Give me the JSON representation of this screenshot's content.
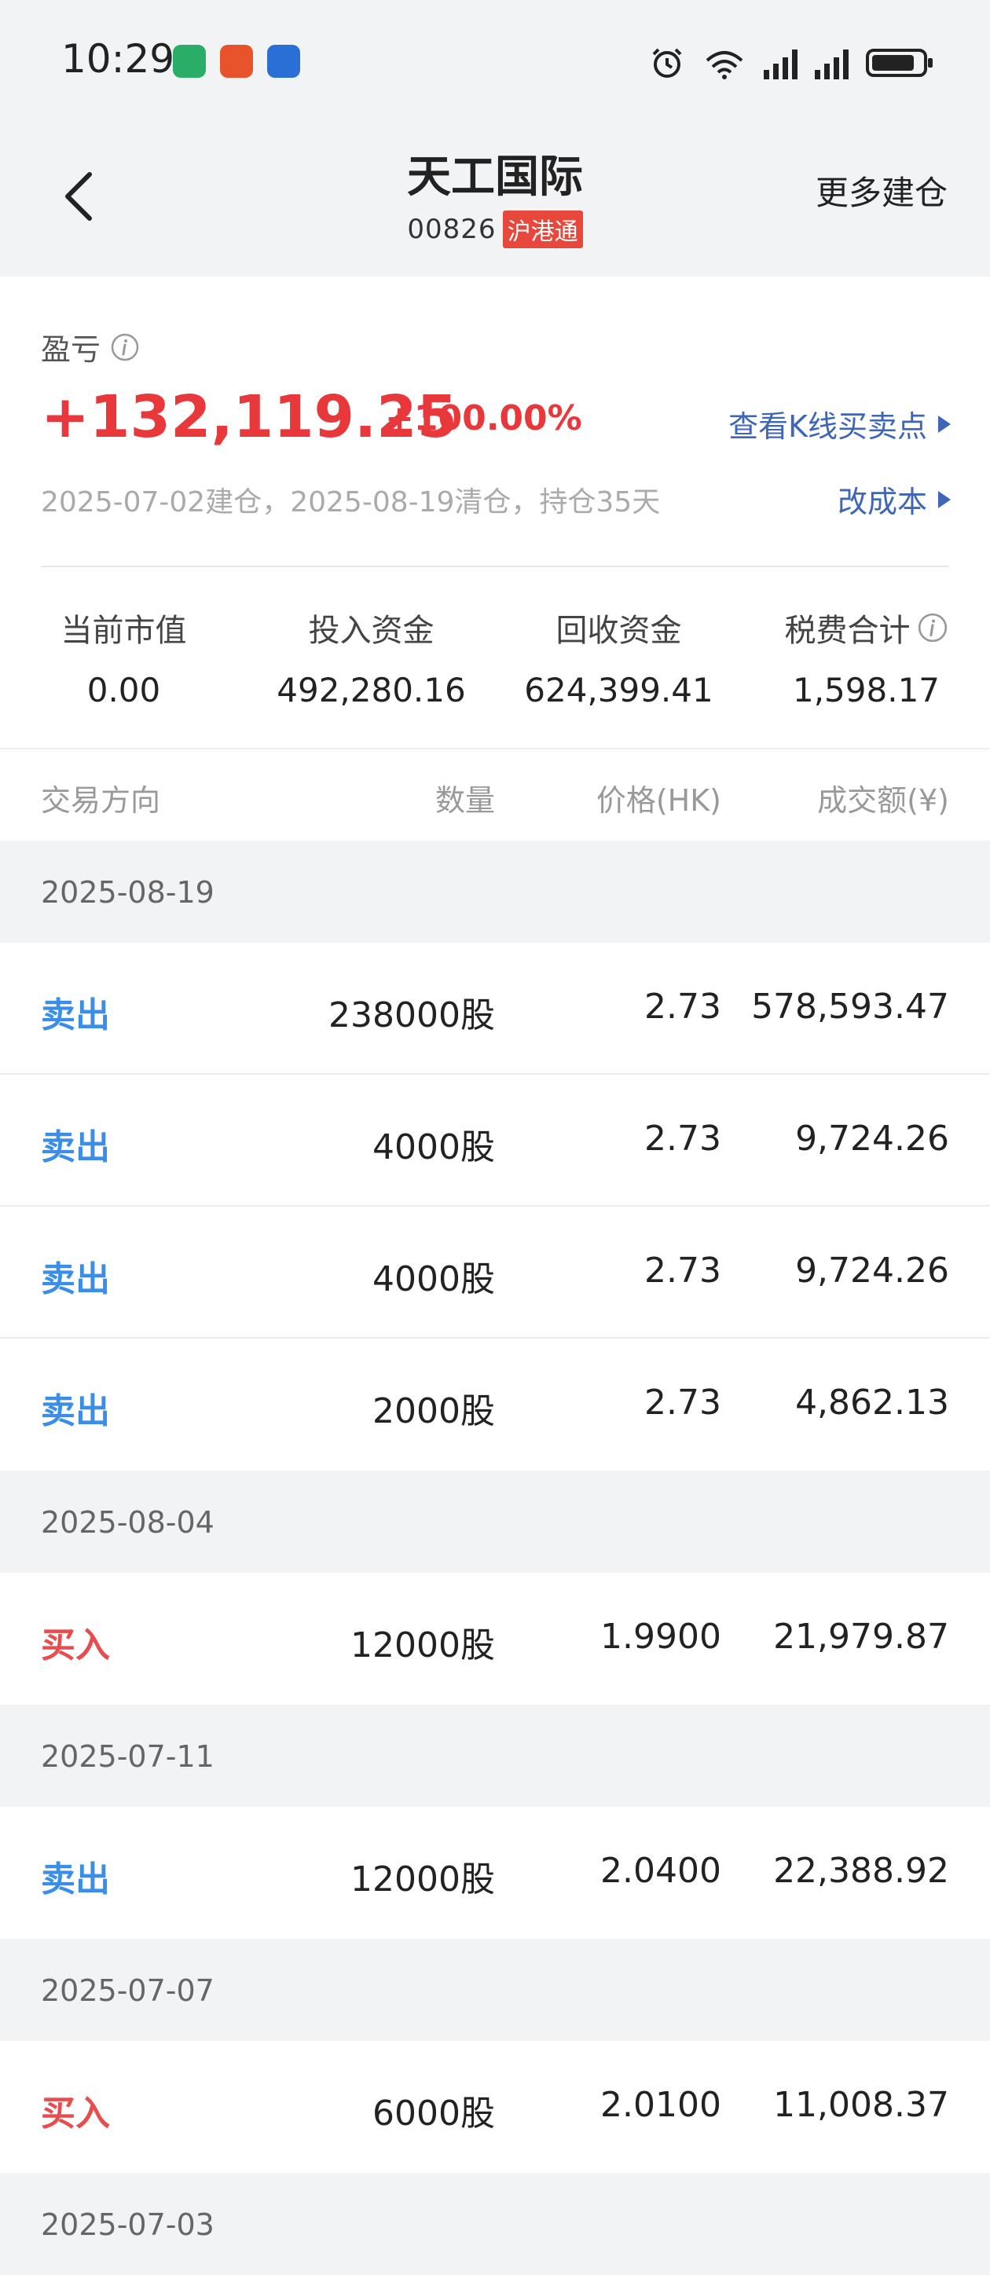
{
  "status_bar": {
    "time": "10:29",
    "icons": [
      "wechat-icon",
      "huaan-securities-icon",
      "car-app-icon",
      "alarm-icon",
      "wifi-icon",
      "signal-icon",
      "battery-icon"
    ],
    "battery_level": 0.85
  },
  "header": {
    "stock_name": "天工国际",
    "stock_code": "00826",
    "market_badge": "沪港通",
    "more_link": "更多建仓"
  },
  "summary": {
    "pl_label": "盈亏",
    "pl_value": "+132,119.25",
    "pl_pct": "+100.00%",
    "kline_link": "查看K线买卖点",
    "period": "2025-07-02建仓，2025-08-19清仓，持仓35天",
    "cost_link": "改成本",
    "stats": [
      {
        "label": "当前市值",
        "value": "0.00"
      },
      {
        "label": "投入资金",
        "value": "492,280.16"
      },
      {
        "label": "回收资金",
        "value": "624,399.41"
      },
      {
        "label": "税费合计",
        "value": "1,598.17"
      }
    ]
  },
  "table": {
    "headers": {
      "direction": "交易方向",
      "quantity": "数量",
      "price": "价格(HK)",
      "amount": "成交额(¥)"
    },
    "groups": [
      {
        "date": "2025-08-19",
        "rows": [
          {
            "direction": "卖出",
            "quantity": "238000股",
            "price": "2.73",
            "amount": "578,593.47"
          },
          {
            "direction": "卖出",
            "quantity": "4000股",
            "price": "2.73",
            "amount": "9,724.26"
          },
          {
            "direction": "卖出",
            "quantity": "4000股",
            "price": "2.73",
            "amount": "9,724.26"
          },
          {
            "direction": "卖出",
            "quantity": "2000股",
            "price": "2.73",
            "amount": "4,862.13"
          }
        ]
      },
      {
        "date": "2025-08-04",
        "rows": [
          {
            "direction": "买入",
            "quantity": "12000股",
            "price": "1.9900",
            "amount": "21,979.87"
          }
        ]
      },
      {
        "date": "2025-07-11",
        "rows": [
          {
            "direction": "卖出",
            "quantity": "12000股",
            "price": "2.0400",
            "amount": "22,388.92"
          }
        ]
      },
      {
        "date": "2025-07-07",
        "rows": [
          {
            "direction": "买入",
            "quantity": "6000股",
            "price": "2.0100",
            "amount": "11,008.37"
          }
        ]
      },
      {
        "date": "2025-07-03",
        "rows": []
      }
    ]
  },
  "colors": {
    "profit_red": "#e8383b",
    "sell_blue": "#3b8ee8",
    "buy_red": "#e84c4c",
    "link_blue": "#3e65b6"
  }
}
